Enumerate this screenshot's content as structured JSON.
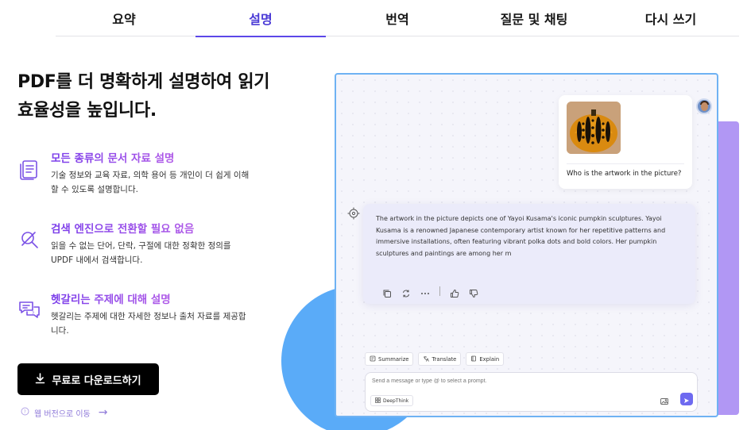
{
  "tabs": [
    {
      "label": "요약",
      "active": false
    },
    {
      "label": "설명",
      "active": true
    },
    {
      "label": "번역",
      "active": false
    },
    {
      "label": "질문 및 채팅",
      "active": false
    },
    {
      "label": "다시 쓰기",
      "active": false
    }
  ],
  "hero": {
    "headline": "PDF를 더 명확하게 설명하여 읽기 효율성을 높입니다."
  },
  "features": [
    {
      "icon": "document-list-icon",
      "title": "모든 종류의 문서 자료 설명",
      "desc": "기술 정보와 교육 자료, 의학 용어 등 개인이 더 쉽게 이해할 수 있도록 설명합니다."
    },
    {
      "icon": "no-search-icon",
      "title": "검색 엔진으로 전환할 필요 없음",
      "desc": "읽을 수 없는 단어, 단락, 구절에 대한 정확한 정의를 UPDF 내에서 검색합니다."
    },
    {
      "icon": "chat-question-icon",
      "title": "헷갈리는 주제에 대해 설명",
      "desc": "헷갈리는 주제에 대한 자세한 정보나 출처 자료를 제공합니다."
    }
  ],
  "download": {
    "label": "무료로 다운로드하기",
    "icon": "download-icon"
  },
  "web_link": {
    "label": "웹 버전으로 이동",
    "icon": "question-circle-icon",
    "arrow": "→"
  },
  "chat": {
    "user_question": "Who is the artwork in the picture?",
    "reply": "The artwork in the picture depicts one of Yayoi Kusama's iconic pumpkin sculptures. Yayoi Kusama is a renowned Japanese contemporary artist known for her repetitive patterns and immersive installations, often featuring vibrant polka dots and bold colors. Her pumpkin sculptures and paintings are among her m",
    "chips": [
      {
        "label": "Summarize",
        "icon": "summarize-icon"
      },
      {
        "label": "Translate",
        "icon": "translate-icon"
      },
      {
        "label": "Explain",
        "icon": "book-icon"
      }
    ],
    "input_placeholder": "Send a message or type @ to select a prompt.",
    "deepthink_label": "DeepThink"
  },
  "colors": {
    "accent": "#5b47e8",
    "feature_gradient_start": "#7a3dea",
    "feature_gradient_end": "#b05ae8",
    "panel_border": "#6fb2f3",
    "blue_blob": "#5aabf8",
    "purple_back": "#b197f4",
    "send_button": "#6e6af0"
  }
}
